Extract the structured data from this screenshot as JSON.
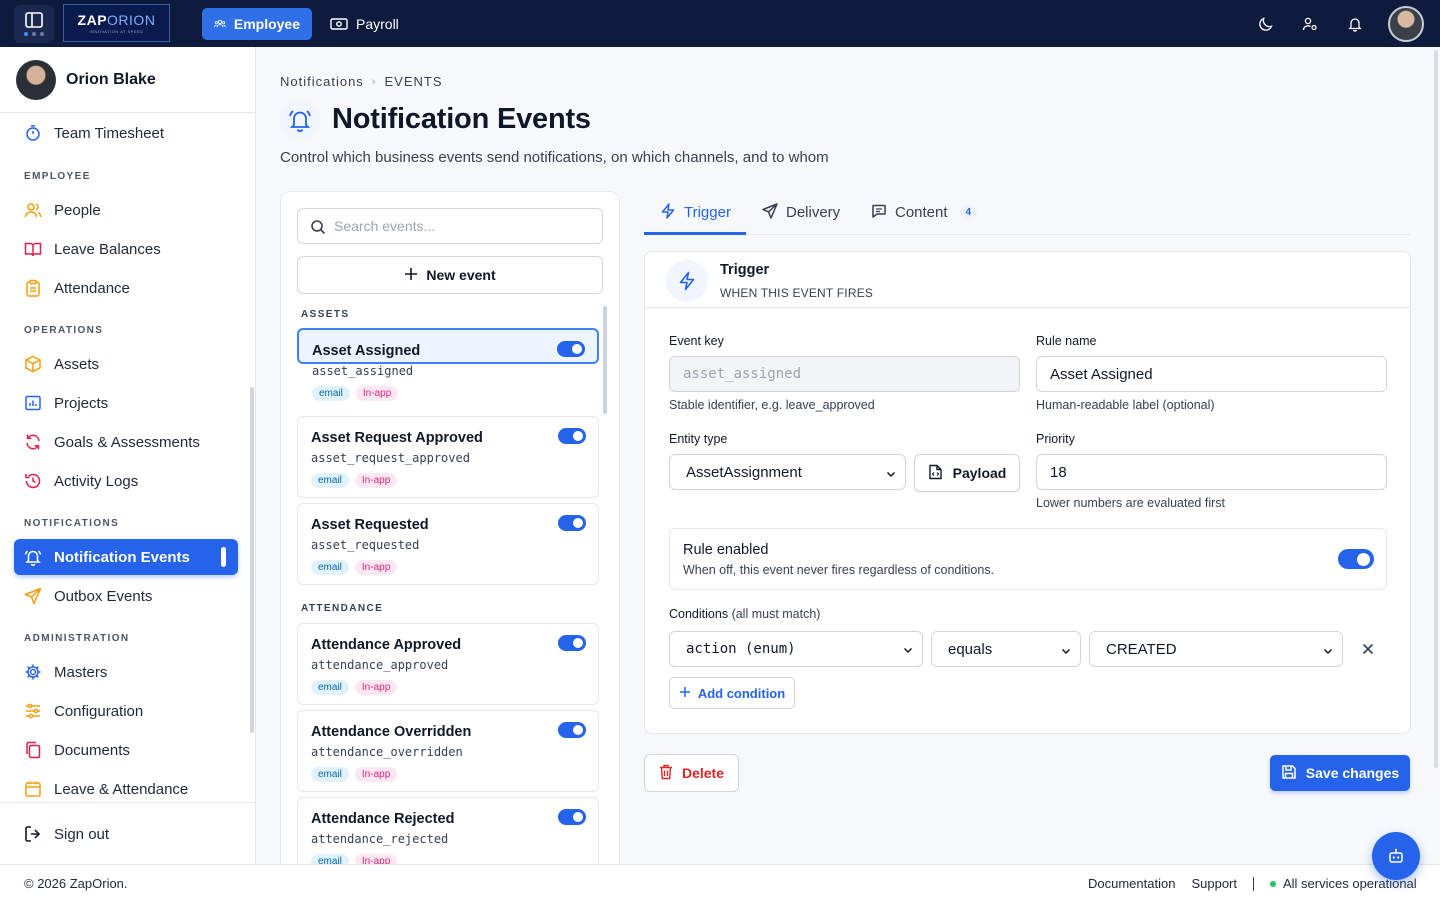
{
  "topbar": {
    "logo_main": "ZAP",
    "logo_accent": "ORION",
    "logo_tagline": "INNOVATION AT SPEED",
    "nav": [
      {
        "label": "Employee",
        "icon": "people-icon",
        "active": true
      },
      {
        "label": "Payroll",
        "icon": "cash-icon",
        "active": false
      }
    ],
    "icons": [
      "moon-icon",
      "user-settings-icon",
      "bell-icon"
    ]
  },
  "sidebar": {
    "user_name": "Orion Blake",
    "top_items": [
      {
        "label": "Team Timesheet",
        "icon": "stopwatch-icon"
      }
    ],
    "sections": [
      {
        "title": "EMPLOYEE",
        "items": [
          {
            "label": "People",
            "icon": "users-icon"
          },
          {
            "label": "Leave Balances",
            "icon": "book-icon"
          },
          {
            "label": "Attendance",
            "icon": "clipboard-icon"
          }
        ]
      },
      {
        "title": "OPERATIONS",
        "items": [
          {
            "label": "Assets",
            "icon": "box-icon"
          },
          {
            "label": "Projects",
            "icon": "chart-icon"
          },
          {
            "label": "Goals & Assessments",
            "icon": "refresh-icon"
          },
          {
            "label": "Activity Logs",
            "icon": "history-icon"
          }
        ]
      },
      {
        "title": "NOTIFICATIONS",
        "items": [
          {
            "label": "Notification Events",
            "icon": "bell-icon",
            "active": true
          },
          {
            "label": "Outbox Events",
            "icon": "send-icon"
          }
        ]
      },
      {
        "title": "ADMINISTRATION",
        "items": [
          {
            "label": "Masters",
            "icon": "gear-icon"
          },
          {
            "label": "Configuration",
            "icon": "sliders-icon"
          },
          {
            "label": "Documents",
            "icon": "copy-icon"
          },
          {
            "label": "Leave & Attendance",
            "icon": "calendar-icon"
          }
        ]
      }
    ],
    "sign_out": "Sign out"
  },
  "breadcrumb": {
    "parent": "Notifications",
    "current": "EVENTS"
  },
  "page": {
    "title": "Notification Events",
    "subtitle": "Control which business events send notifications, on which channels, and to whom"
  },
  "event_list": {
    "search_placeholder": "Search events...",
    "new_event_label": "New event",
    "groups": [
      {
        "title": "ASSETS",
        "events": [
          {
            "title": "Asset Assigned",
            "key": "asset_assigned",
            "channels": [
              "email",
              "In-app"
            ],
            "enabled": true,
            "selected": true
          },
          {
            "title": "Asset Request Approved",
            "key": "asset_request_approved",
            "channels": [
              "email",
              "In-app"
            ],
            "enabled": true
          },
          {
            "title": "Asset Requested",
            "key": "asset_requested",
            "channels": [
              "email",
              "In-app"
            ],
            "enabled": true
          }
        ]
      },
      {
        "title": "ATTENDANCE",
        "events": [
          {
            "title": "Attendance Approved",
            "key": "attendance_approved",
            "channels": [
              "email",
              "In-app"
            ],
            "enabled": true
          },
          {
            "title": "Attendance Overridden",
            "key": "attendance_overridden",
            "channels": [
              "email",
              "In-app"
            ],
            "enabled": true
          },
          {
            "title": "Attendance Rejected",
            "key": "attendance_rejected",
            "channels": [
              "email",
              "In-app"
            ],
            "enabled": true
          }
        ]
      }
    ]
  },
  "tabs": [
    {
      "label": "Trigger",
      "icon": "bolt-icon",
      "active": true
    },
    {
      "label": "Delivery",
      "icon": "send-icon"
    },
    {
      "label": "Content",
      "icon": "message-icon",
      "badge": "4"
    }
  ],
  "trigger": {
    "heading": "Trigger",
    "subheading": "WHEN THIS EVENT FIRES",
    "event_key_label": "Event key",
    "event_key_value": "asset_assigned",
    "event_key_hint": "Stable identifier, e.g. leave_approved",
    "rule_name_label": "Rule name",
    "rule_name_value": "Asset Assigned",
    "rule_name_hint": "Human-readable label (optional)",
    "entity_type_label": "Entity type",
    "entity_type_value": "AssetAssignment",
    "payload_label": "Payload",
    "priority_label": "Priority",
    "priority_value": "18",
    "priority_hint": "Lower numbers are evaluated first",
    "rule_enabled_title": "Rule enabled",
    "rule_enabled_desc": "When off, this event never fires regardless of conditions.",
    "rule_enabled": true,
    "conditions_label": "Conditions",
    "conditions_note": "(all must match)",
    "condition": {
      "field": "action (enum)",
      "operator": "equals",
      "value": "CREATED"
    },
    "add_condition_label": "Add condition"
  },
  "actions": {
    "delete_label": "Delete",
    "save_label": "Save changes"
  },
  "footer": {
    "copyright": "© 2026 ZapOrion.",
    "documentation": "Documentation",
    "support": "Support",
    "status": "All services operational"
  },
  "colors": {
    "accent": "#2563eb",
    "topbar": "#0f1b3d",
    "danger": "#dc2626",
    "status_ok": "#22c55e"
  }
}
